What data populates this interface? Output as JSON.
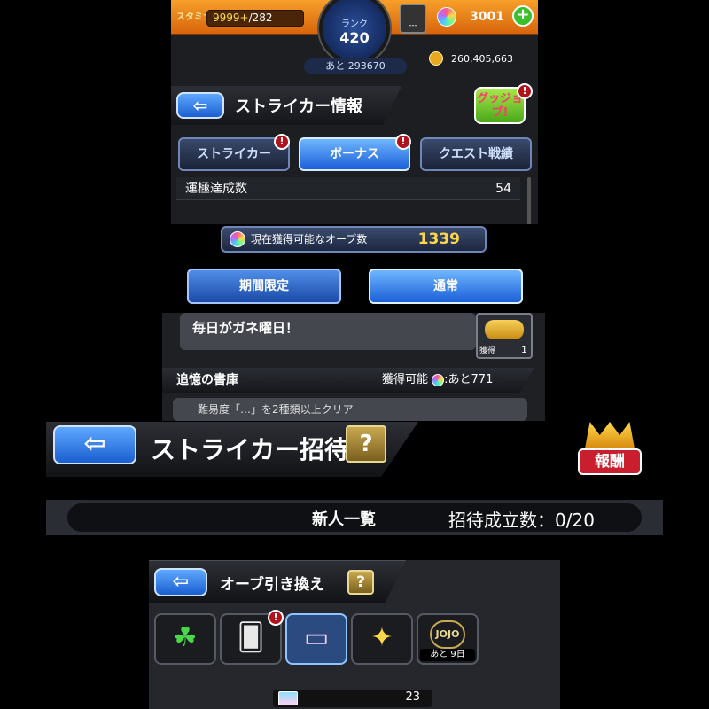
{
  "panel1": {
    "stamina_label": "スタミナ",
    "stamina_current": "9999+",
    "stamina_max": "/282",
    "rank_label": "ランク",
    "rank_value": "420",
    "exp_remaining": "あと 293670",
    "badge_text": "---",
    "orb_count": "3001",
    "gold": "260,405,663",
    "section_title": "ストライカー情報",
    "gujob_label": "グッジョブ!",
    "tabs": [
      {
        "label": "ストライカー",
        "active": false,
        "alert": true
      },
      {
        "label": "ボーナス",
        "active": true,
        "alert": true
      },
      {
        "label": "クエスト戦績",
        "active": false,
        "alert": false
      }
    ],
    "stat_row": {
      "label": "運極達成数",
      "value": "54"
    }
  },
  "panel2": {
    "orb_label": "現在獲得可能なオーブ数",
    "orb_value": "1339",
    "buttons": [
      {
        "label": "期間限定",
        "active": false
      },
      {
        "label": "通常",
        "active": true
      }
    ],
    "mission_text": "毎日がガネ曜日！",
    "coin_box_label": "獲得",
    "coin_box_count": "1",
    "history_title": "追憶の書庫",
    "history_obtainable": "獲得可能",
    "history_remaining": ":あと771",
    "next_row_text": "難易度「…」を2種類以上クリア"
  },
  "panel3": {
    "title": "ストライカー招待",
    "help_label": "?",
    "reward_label": "報酬",
    "new_list": "新人一覧",
    "invite_label": "招待成立数：",
    "invite_count": "0/20"
  },
  "panel4": {
    "title": "オーブ引き換え",
    "help_label": "?",
    "icon_tabs": [
      {
        "name": "clover-hat",
        "glyph": "☘",
        "active": false
      },
      {
        "name": "card-pack",
        "glyph": "🂠",
        "active": false,
        "alert": true
      },
      {
        "name": "orb-ticket",
        "glyph": "▭",
        "active": true
      },
      {
        "name": "yellow-character",
        "glyph": "✦",
        "active": false
      },
      {
        "name": "jojo",
        "glyph": "JOJO",
        "active": false,
        "days_left": "あと 9日"
      }
    ],
    "ticket_count": "23"
  },
  "colors": {
    "accent_blue": "#1b5fd8",
    "top_bar_orange": "#f7a02a",
    "gold": "#ffd84a",
    "alert_red": "#b0121e"
  }
}
